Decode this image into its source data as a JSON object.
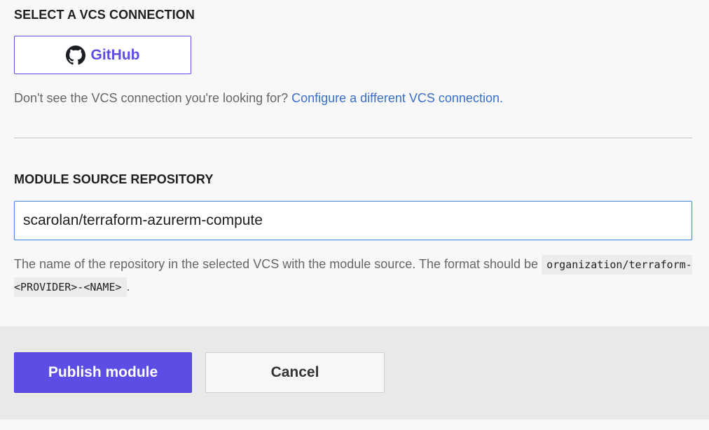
{
  "vcs": {
    "heading": "SELECT A VCS CONNECTION",
    "github_button_label": "GitHub",
    "github_icon": "github-icon",
    "help_text": "Don't see the VCS connection you're looking for? ",
    "help_link": "Configure a different VCS connection."
  },
  "repo": {
    "heading": "MODULE SOURCE REPOSITORY",
    "input_value": "scarolan/terraform-azurerm-compute",
    "help_text_prefix": "The name of the repository in the selected VCS with the module source. The format should be ",
    "help_code": "organization/terraform-<PROVIDER>-<NAME>",
    "help_text_suffix": "."
  },
  "actions": {
    "publish_label": "Publish module",
    "cancel_label": "Cancel"
  },
  "colors": {
    "accent": "#5c4ee5",
    "link": "#3a6fc9",
    "input_focus_border": "#4d8ee8"
  }
}
